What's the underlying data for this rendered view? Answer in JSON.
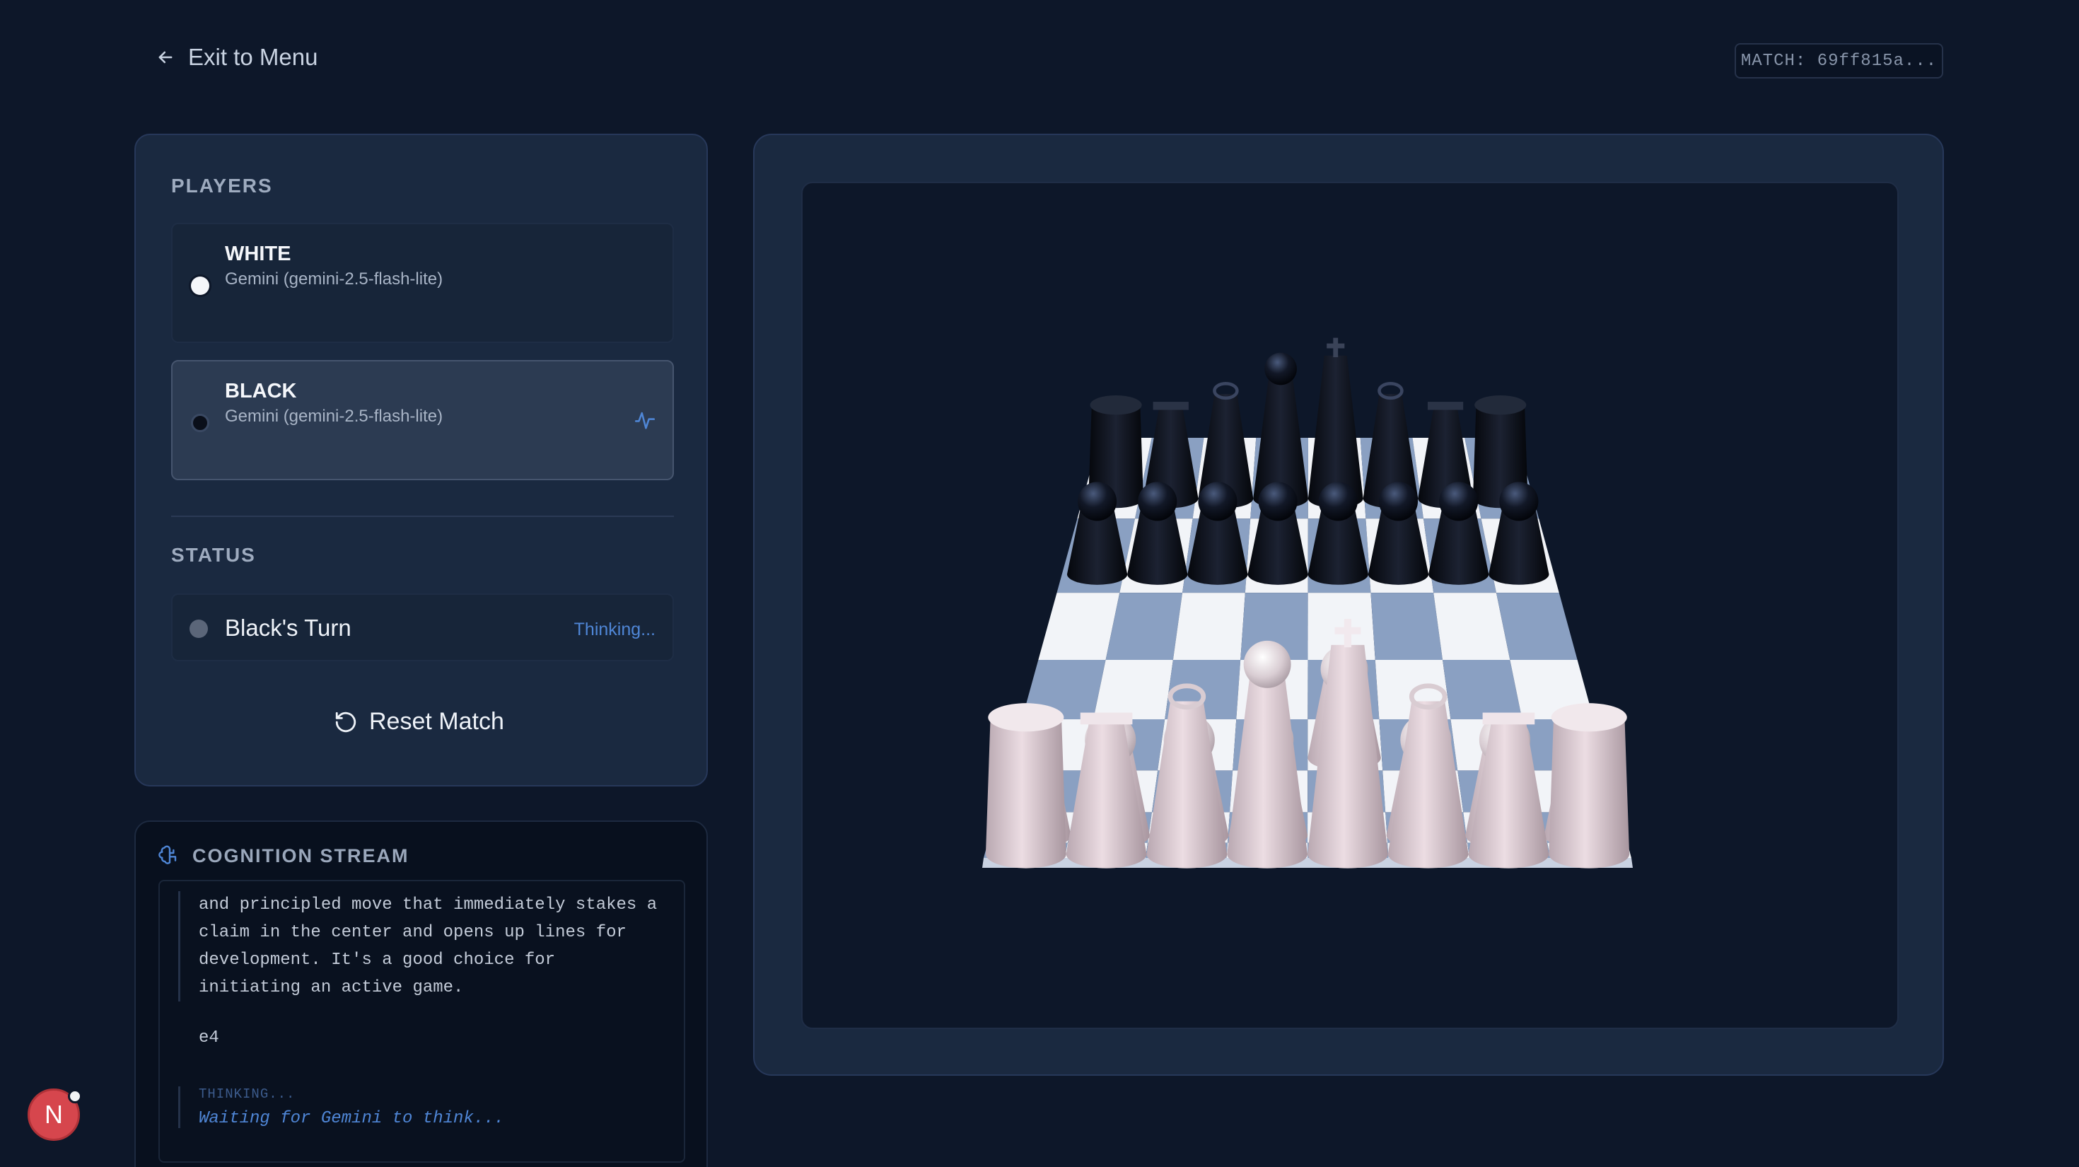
{
  "nav": {
    "exit_label": "Exit to Menu",
    "match_id": "MATCH: 69ff815a..."
  },
  "players": {
    "title": "PLAYERS",
    "white": {
      "name": "WHITE",
      "model": "Gemini (gemini-2.5-flash-lite)"
    },
    "black": {
      "name": "BLACK",
      "model": "Gemini (gemini-2.5-flash-lite)",
      "active": true
    }
  },
  "status": {
    "title": "STATUS",
    "turn": "Black's Turn",
    "state": "Thinking..."
  },
  "reset_label": "Reset Match",
  "cognition": {
    "title": "COGNITION STREAM",
    "text": "and principled move that immediately stakes a\nclaim in the center and opens up lines for\ndevelopment. It's a good choice for\ninitiating an active game.",
    "move": "e4",
    "thinking_label": "THINKING...",
    "thinking_text": "Waiting for Gemini to think..."
  },
  "avatar_letter": "N",
  "colors": {
    "accent": "#4f86d6",
    "light_square": "#f2f4f8",
    "dark_square": "#8aa0c2",
    "black_piece": "#0b0f17",
    "white_piece": "#d8c8cf"
  },
  "board": {
    "last_move": "e4",
    "white_pieces": [
      "a1 rook",
      "b1 knight",
      "c1 bishop",
      "d1 queen",
      "e1 king",
      "f1 bishop",
      "g1 knight",
      "h1 rook",
      "a2 pawn",
      "b2 pawn",
      "c2 pawn",
      "d2 pawn",
      "f2 pawn",
      "g2 pawn",
      "h2 pawn",
      "e4 pawn"
    ],
    "black_pieces": [
      "a8 rook",
      "b8 knight",
      "c8 bishop",
      "d8 queen",
      "e8 king",
      "f8 bishop",
      "g8 knight",
      "h8 rook",
      "a7 pawn",
      "b7 pawn",
      "c7 pawn",
      "d7 pawn",
      "e7 pawn",
      "f7 pawn",
      "g7 pawn",
      "h7 pawn"
    ]
  }
}
